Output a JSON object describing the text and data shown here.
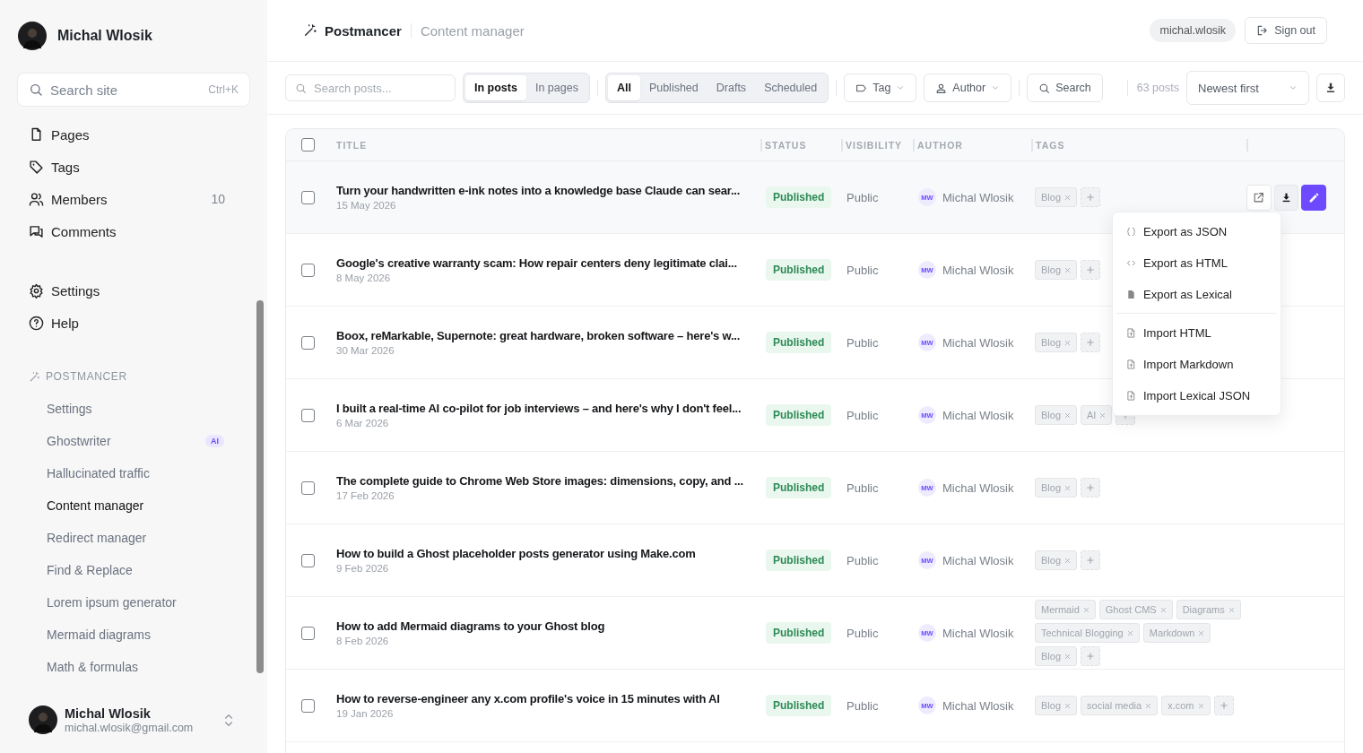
{
  "sidebar": {
    "user": {
      "name": "Michal Wlosik"
    },
    "search": {
      "placeholder": "Search site",
      "shortcut": "Ctrl+K"
    },
    "nav": [
      {
        "kind": "pages",
        "label": "Pages"
      },
      {
        "kind": "tags",
        "label": "Tags"
      },
      {
        "kind": "members",
        "label": "Members",
        "count": "10"
      },
      {
        "kind": "comments",
        "label": "Comments"
      }
    ],
    "nav_bottom": [
      {
        "kind": "settings",
        "label": "Settings"
      },
      {
        "kind": "help",
        "label": "Help"
      }
    ],
    "section": {
      "title": "POSTMANCER",
      "items": [
        {
          "label": "Settings",
          "selected": false
        },
        {
          "label": "Ghostwriter",
          "selected": false,
          "badge": "AI"
        },
        {
          "label": "Hallucinated traffic",
          "selected": false
        },
        {
          "label": "Content manager",
          "selected": true
        },
        {
          "label": "Redirect manager",
          "selected": false
        },
        {
          "label": "Find & Replace",
          "selected": false
        },
        {
          "label": "Lorem ipsum generator",
          "selected": false
        },
        {
          "label": "Mermaid diagrams",
          "selected": false
        },
        {
          "label": "Math & formulas",
          "selected": false
        }
      ]
    },
    "footer": {
      "name": "Michal Wlosik",
      "email": "michal.wlosik@gmail.com"
    }
  },
  "header": {
    "brand": "Postmancer",
    "subtitle": "Content manager",
    "user": "michal.wlosik",
    "sign_out": "Sign out"
  },
  "toolbar": {
    "search": {
      "placeholder": "Search posts..."
    },
    "scope_tabs": [
      {
        "label": "In posts",
        "selected": true
      },
      {
        "label": "In pages",
        "selected": false
      }
    ],
    "status_tabs": [
      {
        "label": "All",
        "selected": true
      },
      {
        "label": "Published",
        "selected": false
      },
      {
        "label": "Drafts",
        "selected": false
      },
      {
        "label": "Scheduled",
        "selected": false
      }
    ],
    "tag_filter": "Tag",
    "author_filter": "Author",
    "search_button": "Search",
    "count": "63 posts",
    "sort": "Newest first"
  },
  "table": {
    "select_all": {
      "checked": false
    },
    "columns": [
      "TITLE",
      "STATUS",
      "VISIBILITY",
      "AUTHOR",
      "TAGS"
    ],
    "rows": [
      {
        "title": "Turn your handwritten e-ink notes into a knowledge base Claude can sear...",
        "date": "15 May 2026",
        "status": "Published",
        "visibility": "Public",
        "initials": "MW",
        "author": "Michal Wlosik",
        "tags": [
          "Blog"
        ],
        "checked": false,
        "hovered": true
      },
      {
        "title": "Google's creative warranty scam: How repair centers deny legitimate clai...",
        "date": "8 May 2026",
        "status": "Published",
        "visibility": "Public",
        "initials": "MW",
        "author": "Michal Wlosik",
        "tags": [
          "Blog"
        ],
        "checked": false,
        "hovered": false
      },
      {
        "title": "Boox, reMarkable, Supernote: great hardware, broken software – here's w...",
        "date": "30 Mar 2026",
        "status": "Published",
        "visibility": "Public",
        "initials": "MW",
        "author": "Michal Wlosik",
        "tags": [
          "Blog"
        ],
        "checked": false,
        "hovered": false
      },
      {
        "title": "I built a real-time AI co-pilot for job interviews – and here's why I don't feel...",
        "date": "6 Mar 2026",
        "status": "Published",
        "visibility": "Public",
        "initials": "MW",
        "author": "Michal Wlosik",
        "tags": [
          "Blog",
          "AI"
        ],
        "checked": false,
        "hovered": false
      },
      {
        "title": "The complete guide to Chrome Web Store images: dimensions, copy, and ...",
        "date": "17 Feb 2026",
        "status": "Published",
        "visibility": "Public",
        "initials": "MW",
        "author": "Michal Wlosik",
        "tags": [
          "Blog"
        ],
        "checked": false,
        "hovered": false
      },
      {
        "title": "How to build a Ghost placeholder posts generator using Make.com",
        "date": "9 Feb 2026",
        "status": "Published",
        "visibility": "Public",
        "initials": "MW",
        "author": "Michal Wlosik",
        "tags": [
          "Blog"
        ],
        "checked": false,
        "hovered": false
      },
      {
        "title": "How to add Mermaid diagrams to your Ghost blog",
        "date": "8 Feb 2026",
        "status": "Published",
        "visibility": "Public",
        "initials": "MW",
        "author": "Michal Wlosik",
        "tags": [
          "Mermaid",
          "Ghost CMS",
          "Diagrams",
          "Technical Blogging",
          "Markdown",
          "Blog"
        ],
        "checked": false,
        "hovered": false
      },
      {
        "title": "How to reverse-engineer any x.com profile's voice in 15 minutes with AI",
        "date": "19 Jan 2026",
        "status": "Published",
        "visibility": "Public",
        "initials": "MW",
        "author": "Michal Wlosik",
        "tags": [
          "Blog",
          "social media",
          "x.com"
        ],
        "checked": false,
        "hovered": false
      }
    ]
  },
  "menu": {
    "export": [
      {
        "kind": "json",
        "label": "Export as JSON"
      },
      {
        "kind": "html",
        "label": "Export as HTML"
      },
      {
        "kind": "lexical",
        "label": "Export as Lexical"
      }
    ],
    "import": [
      {
        "kind": "import",
        "label": "Import HTML"
      },
      {
        "kind": "import",
        "label": "Import Markdown"
      },
      {
        "kind": "import",
        "label": "Import Lexical JSON"
      }
    ]
  }
}
